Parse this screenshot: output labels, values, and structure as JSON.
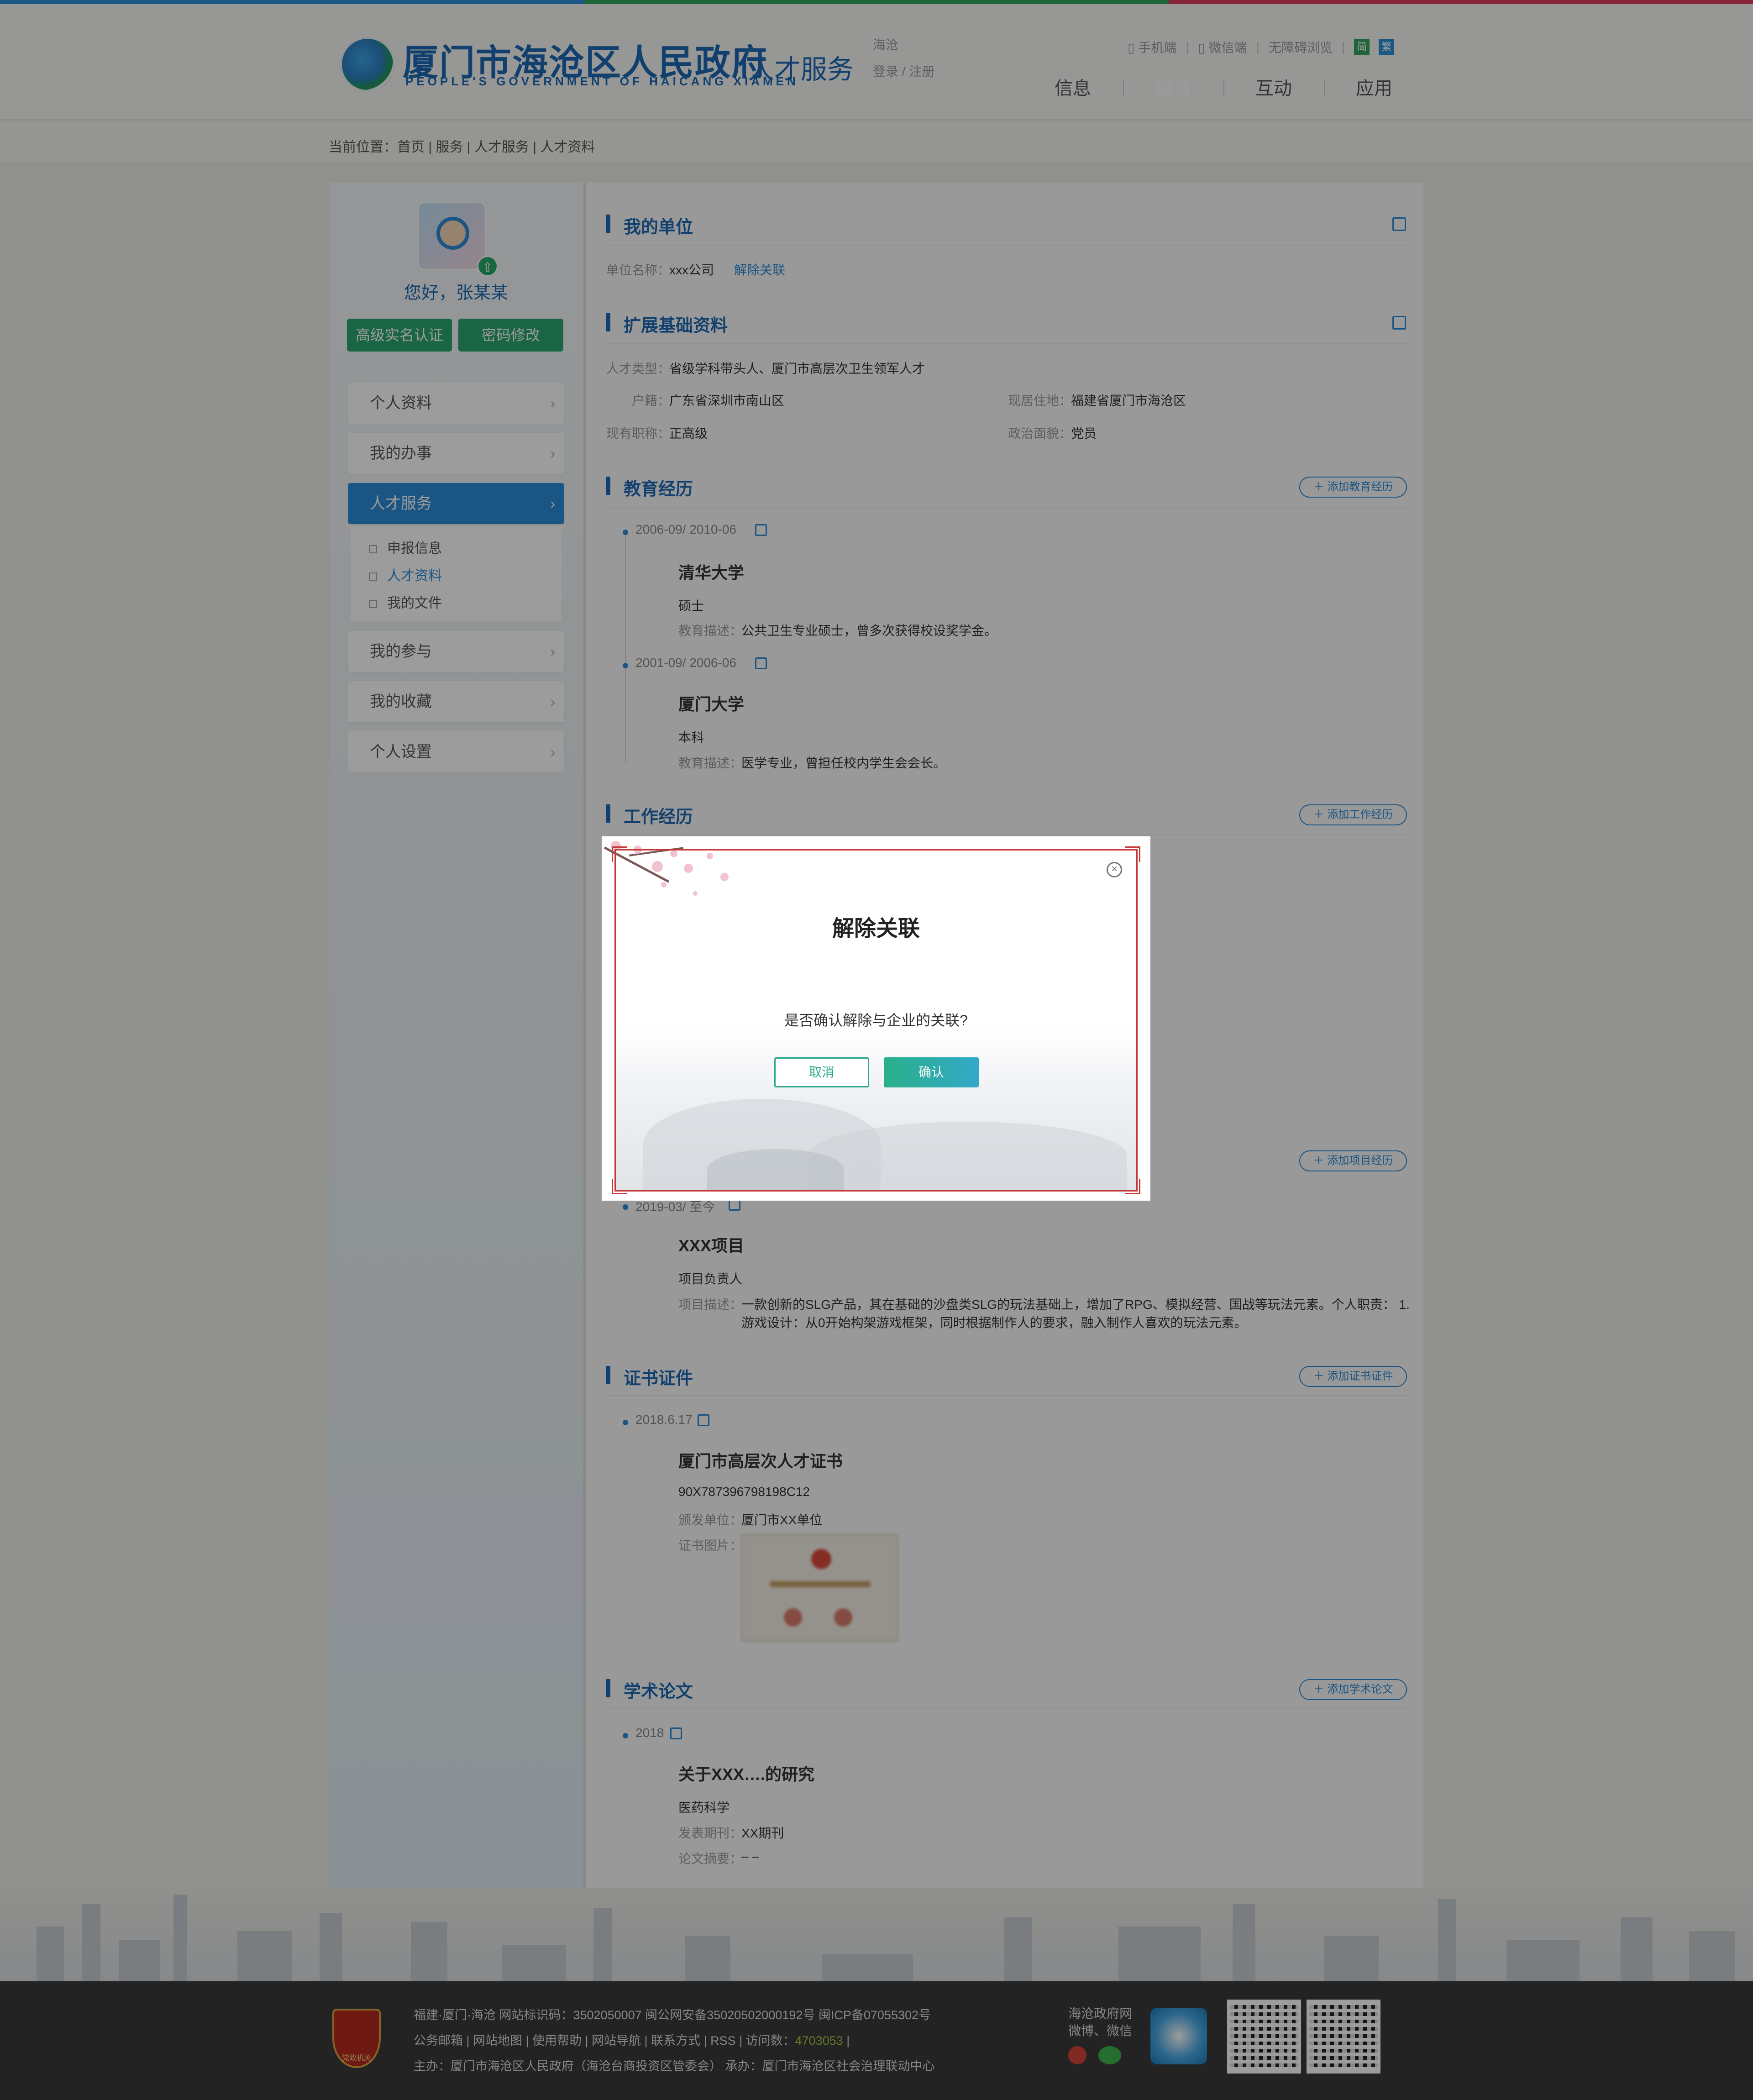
{
  "colors": {
    "topline": [
      "#2a8fd8",
      "#35a55f",
      "#d93a5a"
    ],
    "brand": "#1d69b4",
    "accent": "#2c8bd8",
    "green": "#2aa56f"
  },
  "header": {
    "title": "厦门市海沧区人民政府",
    "subtitle_en": "PEOPLE'S GOVERNMENT OF HAICANG XIAMEN",
    "section": "人才服务",
    "location": "海沧",
    "login": "登录 / 注册",
    "links": {
      "mobile": "手机端",
      "wechat": "微信端",
      "accessibility": "无障碍浏览",
      "badge1": "简",
      "badge2": "繁"
    },
    "nav": [
      "信息",
      "服务",
      "互动",
      "应用"
    ]
  },
  "breadcrumb": "当前位置：首页 | 服务  | 人才服务 | 人才资料",
  "sidebar": {
    "greeting": "您好，张某某",
    "btn_auth": "高级实名认证",
    "btn_password": "密码修改",
    "menu": [
      "个人资料",
      "我的办事",
      "人才服务",
      "我的参与",
      "我的收藏",
      "个人设置"
    ],
    "submenu": [
      "申报信息",
      "人才资料",
      "我的文件"
    ]
  },
  "unit": {
    "title": "我的单位",
    "label": "单位名称：",
    "value": "xxx公司",
    "unlink": "解除关联"
  },
  "basic": {
    "title": "扩展基础资料",
    "type_label": "人才类型：",
    "type_value": "省级学科带头人、厦门市高层次卫生领军人才",
    "hukou_label": "户籍：",
    "hukou_value": "广东省深圳市南山区",
    "residence_label": "现居住地：",
    "residence_value": "福建省厦门市海沧区",
    "title_label": "现有职称：",
    "title_value": "正高级",
    "politics_label": "政治面貌：",
    "politics_value": "党员"
  },
  "education": {
    "title": "教育经历",
    "add": "添加教育经历",
    "items": [
      {
        "date": "2006-09/ 2010-06",
        "school": "清华大学",
        "degree": "硕士",
        "desc_label": "教育描述：",
        "desc": "公共卫生专业硕士，曾多次获得校设奖学金。"
      },
      {
        "date": "2001-09/ 2006-06",
        "school": "厦门大学",
        "degree": "本科",
        "desc_label": "教育描述：",
        "desc": "医学专业，曾担任校内学生会会长。"
      }
    ]
  },
  "work": {
    "title": "工作经历",
    "add": "添加工作经历"
  },
  "project": {
    "add": "添加项目经历",
    "date": "2019-03/ 至今",
    "name": "XXX项目",
    "role": "项目负责人",
    "desc_label": "项目描述：",
    "desc_line1": "一款创新的SLG产品，其在基础的沙盘类SLG的玩法基础上，增加了RPG、模拟经营、国战等玩法元素。个人职责： 1.",
    "desc_line2": "游戏设计：从0开始构架游戏框架，同时根据制作人的要求，融入制作人喜欢的玩法元素。"
  },
  "certificate": {
    "title": "证书证件",
    "add": "添加证书证件",
    "date": "2018.6.17",
    "name": "厦门市高层次人才证书",
    "number": "90X787396798198C12",
    "issuer_label": "颁发单位：",
    "issuer": "厦门市XX单位",
    "image_label": "证书图片："
  },
  "paper": {
    "title": "学术论文",
    "add": "添加学术论文",
    "date": "2018",
    "name": "关于XXX….的研究",
    "field": "医药科学",
    "journal_label": "发表期刊：",
    "journal": "XX期刊",
    "abstract_label": "论文摘要：",
    "abstract": "– –"
  },
  "footer": {
    "line1": "福建·厦门·海沧   网站标识码：3502050007   闽公网安备35020502000192号   闽ICP备07055302号",
    "line2_prefix": "公务邮箱 | 网站地图 | 使用帮助 | 网站导航 | 联系方式 | RSS | 访问数：",
    "visits": "4703053",
    "line2_suffix": " |",
    "line3": "主办：厦门市海沧区人民政府（海沧台商投资区管委会） 承办：厦门市海沧区社会治理联动中心",
    "social_title1": "海沧政府网",
    "social_title2": "微博、微信",
    "badge_text": "党政机关"
  },
  "modal": {
    "title": "解除关联",
    "message": "是否确认解除与企业的关联?",
    "cancel": "取消",
    "confirm": "确认",
    "close_icon": "close-icon"
  }
}
